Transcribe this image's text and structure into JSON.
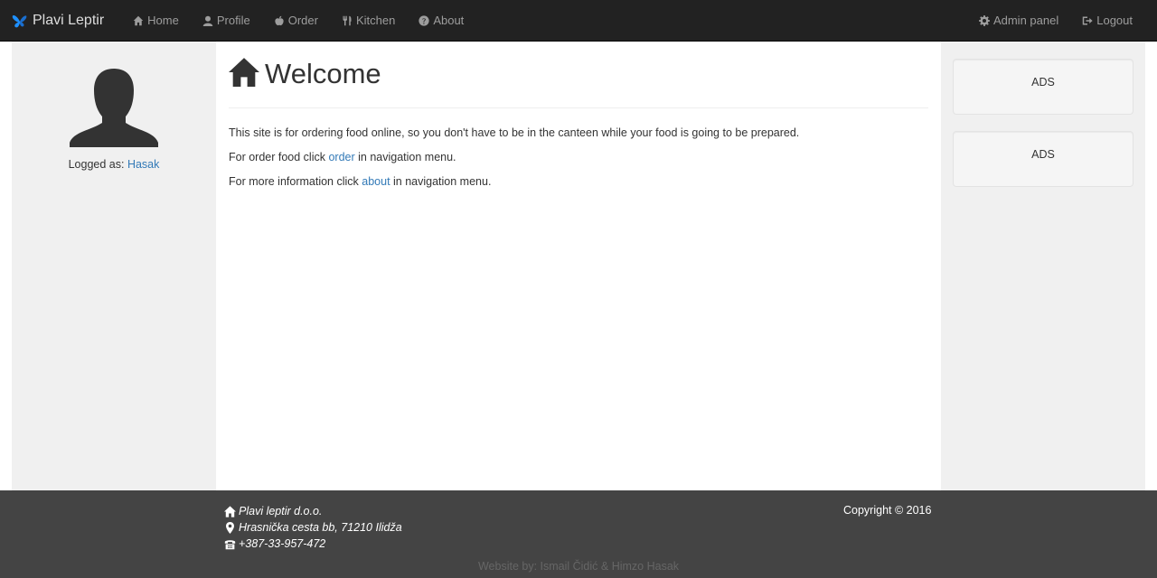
{
  "navbar": {
    "brand": "Plavi Leptir",
    "left_items": [
      {
        "label": "Home",
        "icon": "home-icon"
      },
      {
        "label": "Profile",
        "icon": "user-icon"
      },
      {
        "label": "Order",
        "icon": "apple-icon"
      },
      {
        "label": "Kitchen",
        "icon": "cutlery-icon"
      },
      {
        "label": "About",
        "icon": "question-icon"
      }
    ],
    "right_items": [
      {
        "label": "Admin panel",
        "icon": "gear-icon"
      },
      {
        "label": "Logout",
        "icon": "logout-icon"
      }
    ],
    "colors": {
      "background": "#222222",
      "text": "#9d9d9d",
      "brand_logo": "#1e90ff"
    }
  },
  "sidebar": {
    "logged_prefix": "Logged as:",
    "username": "Hasak"
  },
  "main": {
    "title": "Welcome",
    "paragraphs": {
      "p1": "This site is for ordering food online, so you don't have to be in the canteen while your food is going to be prepared.",
      "p2_before": "For order food click ",
      "p2_link": "order",
      "p2_after": " in navigation menu.",
      "p3_before": "For more information click ",
      "p3_link": "about",
      "p3_after": " in navigation menu."
    }
  },
  "ads": [
    "ADS",
    "ADS"
  ],
  "footer": {
    "company": "Plavi leptir d.o.o.",
    "address": "Hrasnička cesta bb, 71210 Ilidža",
    "phone": "+387-33-957-472",
    "copyright": "Copyright © 2016",
    "credit": "Website by: Ismail Čidić & Himzo Hasak"
  }
}
